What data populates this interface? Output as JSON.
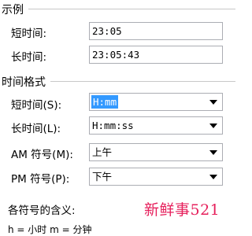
{
  "example": {
    "title": "示例",
    "short_time_label": "短时间:",
    "short_time_value": "23:05",
    "long_time_label": "长时间:",
    "long_time_value": "23:05:43"
  },
  "time_format": {
    "title": "时间格式",
    "short_time_label": "短时间(S):",
    "short_time_value": "H:mm",
    "long_time_label": "长时间(L):",
    "long_time_value": "H:mm:ss",
    "am_label": "AM 符号(M):",
    "am_value": "上午",
    "pm_label": "PM 符号(P):",
    "pm_value": "下午"
  },
  "symbols": {
    "meaning_label": "各符号的含义:",
    "partial_row": "h = 小时 m = 分钟"
  },
  "watermark": {
    "text": "新鲜事521"
  },
  "colors": {
    "selection": "#3399ff",
    "watermark": "#e6205c"
  }
}
